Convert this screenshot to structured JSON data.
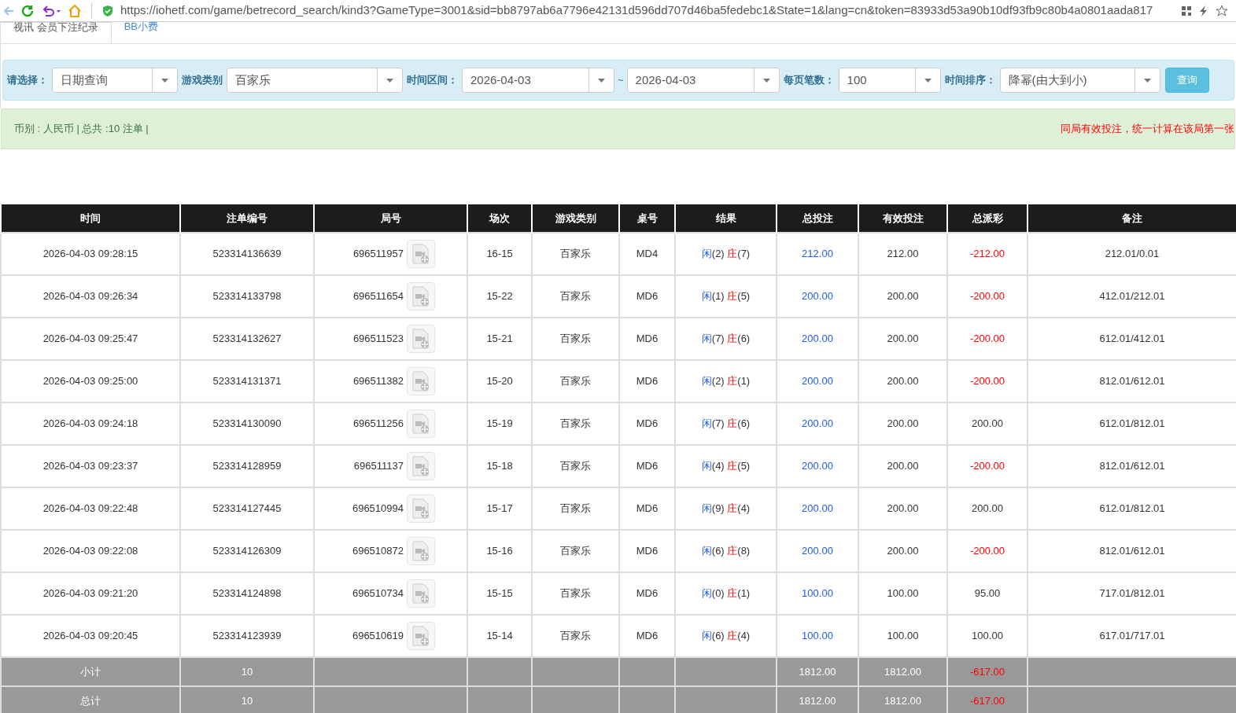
{
  "browser": {
    "url": "https://iohetf.com/game/betrecord_search/kind3?GameType=3001&sid=bb8797ab6a7796e42131d596dd707d46ba5fedebc1&State=1&lang=cn&token=83933d53a90b10df93fb9c80b4a0801aada817"
  },
  "tabs": [
    {
      "label": "视讯 会员下注纪录",
      "selected": true
    },
    {
      "label": "BB小费",
      "selected": false
    }
  ],
  "filters": [
    {
      "label": "请选择：",
      "value": "日期查询",
      "kind": "select"
    },
    {
      "label": "游戏类别",
      "value": "百家乐",
      "kind": "select"
    },
    {
      "label": "时间区间：",
      "value": "2026-04-03",
      "kind": "date_range",
      "separator": "~",
      "end_value": "2026-04-03"
    },
    {
      "label": "每页笔数：",
      "value": "100",
      "kind": "select"
    },
    {
      "label": "时间排序：",
      "value": "降幂(由大到小)",
      "kind": "select"
    }
  ],
  "query_button": "查询",
  "summary": {
    "text": "币别 : 人民币 | 总共 :10 注单 |",
    "notice": "同局有效投注，统一计算在该局第一张"
  },
  "table": {
    "columns": [
      "时间",
      "注单编号",
      "局号",
      "场次",
      "游戏类别",
      "桌号",
      "结果",
      "总投注",
      "有效投注",
      "总派彩",
      "备注"
    ],
    "rows": [
      {
        "time": "2026-04-03 09:28:15",
        "bet_no": "523314136639",
        "round_no": "696511957",
        "session": "16-15",
        "game": "百家乐",
        "table": "MD4",
        "player": "闲",
        "player_count": "(2)",
        "banker": "庄",
        "banker_count": "(7)",
        "total_bet": "212.00",
        "valid_bet": "212.00",
        "payout": "-212.00",
        "loss": true,
        "note": "212.01/0.01"
      },
      {
        "time": "2026-04-03 09:26:34",
        "bet_no": "523314133798",
        "round_no": "696511654",
        "session": "15-22",
        "game": "百家乐",
        "table": "MD6",
        "player": "闲",
        "player_count": "(1)",
        "banker": "庄",
        "banker_count": "(5)",
        "total_bet": "200.00",
        "valid_bet": "200.00",
        "payout": "-200.00",
        "loss": true,
        "note": "412.01/212.01"
      },
      {
        "time": "2026-04-03 09:25:47",
        "bet_no": "523314132627",
        "round_no": "696511523",
        "session": "15-21",
        "game": "百家乐",
        "table": "MD6",
        "player": "闲",
        "player_count": "(7)",
        "banker": "庄",
        "banker_count": "(6)",
        "total_bet": "200.00",
        "valid_bet": "200.00",
        "payout": "-200.00",
        "loss": true,
        "note": "612.01/412.01"
      },
      {
        "time": "2026-04-03 09:25:00",
        "bet_no": "523314131371",
        "round_no": "696511382",
        "session": "15-20",
        "game": "百家乐",
        "table": "MD6",
        "player": "闲",
        "player_count": "(2)",
        "banker": "庄",
        "banker_count": "(1)",
        "total_bet": "200.00",
        "valid_bet": "200.00",
        "payout": "-200.00",
        "loss": true,
        "note": "812.01/612.01"
      },
      {
        "time": "2026-04-03 09:24:18",
        "bet_no": "523314130090",
        "round_no": "696511256",
        "session": "15-19",
        "game": "百家乐",
        "table": "MD6",
        "player": "闲",
        "player_count": "(7)",
        "banker": "庄",
        "banker_count": "(6)",
        "total_bet": "200.00",
        "valid_bet": "200.00",
        "payout": "200.00",
        "loss": false,
        "note": "612.01/812.01"
      },
      {
        "time": "2026-04-03 09:23:37",
        "bet_no": "523314128959",
        "round_no": "696511137",
        "session": "15-18",
        "game": "百家乐",
        "table": "MD6",
        "player": "闲",
        "player_count": "(4)",
        "banker": "庄",
        "banker_count": "(5)",
        "total_bet": "200.00",
        "valid_bet": "200.00",
        "payout": "-200.00",
        "loss": true,
        "note": "812.01/612.01"
      },
      {
        "time": "2026-04-03 09:22:48",
        "bet_no": "523314127445",
        "round_no": "696510994",
        "session": "15-17",
        "game": "百家乐",
        "table": "MD6",
        "player": "闲",
        "player_count": "(9)",
        "banker": "庄",
        "banker_count": "(4)",
        "total_bet": "200.00",
        "valid_bet": "200.00",
        "payout": "200.00",
        "loss": false,
        "note": "612.01/812.01"
      },
      {
        "time": "2026-04-03 09:22:08",
        "bet_no": "523314126309",
        "round_no": "696510872",
        "session": "15-16",
        "game": "百家乐",
        "table": "MD6",
        "player": "闲",
        "player_count": "(6)",
        "banker": "庄",
        "banker_count": "(8)",
        "total_bet": "200.00",
        "valid_bet": "200.00",
        "payout": "-200.00",
        "loss": true,
        "note": "812.01/612.01"
      },
      {
        "time": "2026-04-03 09:21:20",
        "bet_no": "523314124898",
        "round_no": "696510734",
        "session": "15-15",
        "game": "百家乐",
        "table": "MD6",
        "player": "闲",
        "player_count": "(0)",
        "banker": "庄",
        "banker_count": "(1)",
        "total_bet": "100.00",
        "valid_bet": "100.00",
        "payout": "95.00",
        "loss": false,
        "note": "717.01/812.01"
      },
      {
        "time": "2026-04-03 09:20:45",
        "bet_no": "523314123939",
        "round_no": "696510619",
        "session": "15-14",
        "game": "百家乐",
        "table": "MD6",
        "player": "闲",
        "player_count": "(6)",
        "banker": "庄",
        "banker_count": "(4)",
        "total_bet": "100.00",
        "valid_bet": "100.00",
        "payout": "100.00",
        "loss": false,
        "note": "617.01/717.01"
      }
    ],
    "totals": [
      {
        "label": "小计",
        "count": "10",
        "total_bet": "1812.00",
        "valid_bet": "1812.00",
        "payout": "-617.00"
      },
      {
        "label": "总计",
        "count": "10",
        "total_bet": "1812.00",
        "valid_bet": "1812.00",
        "payout": "-617.00"
      }
    ]
  }
}
